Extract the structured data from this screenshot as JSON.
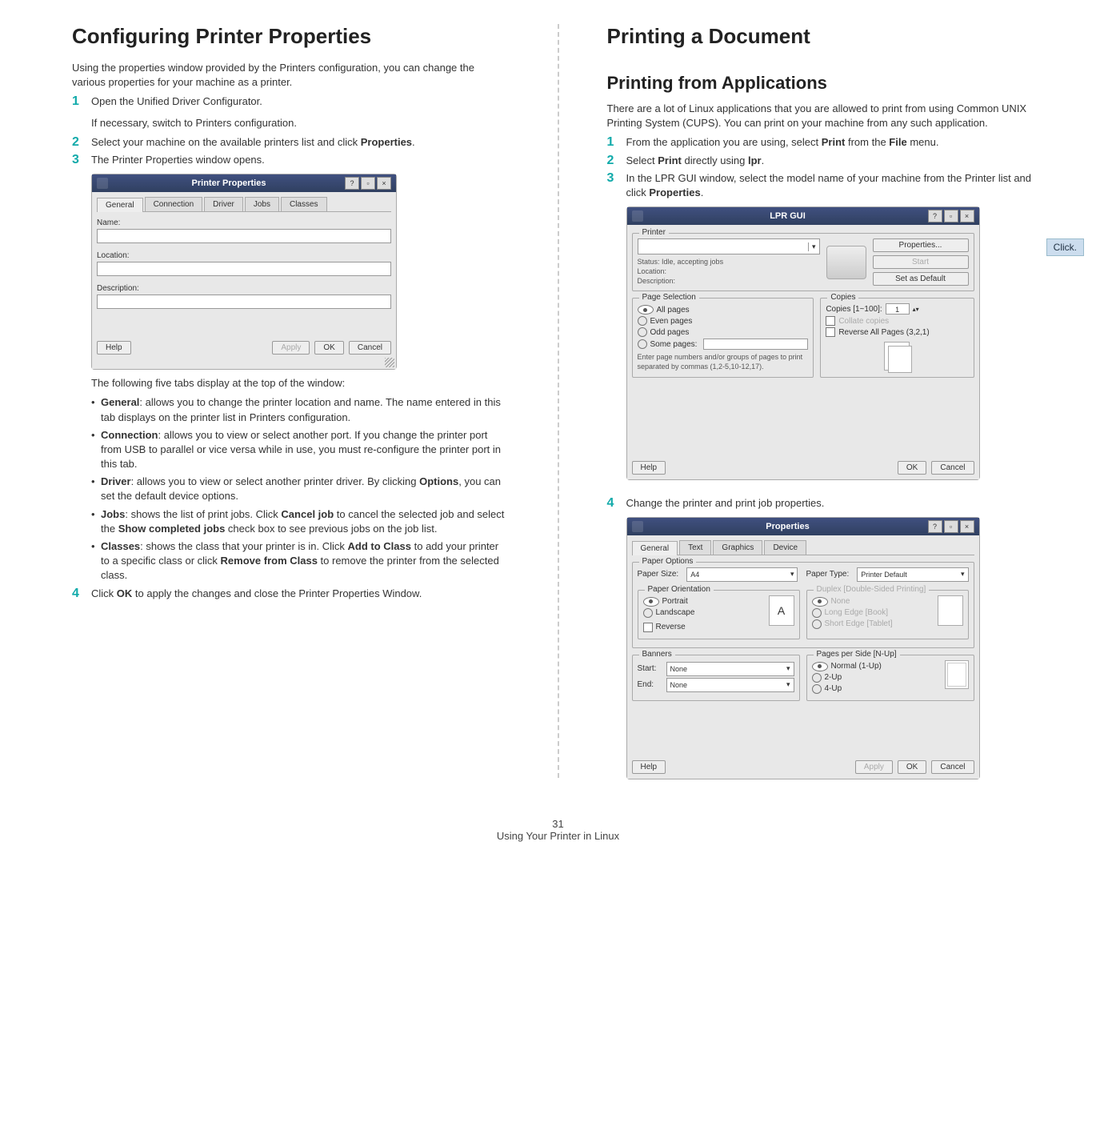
{
  "left": {
    "h1": "Configuring Printer Properties",
    "intro": "Using the properties window provided by the Printers configuration, you can change the various properties for your machine as a printer.",
    "step1": "Open the Unified Driver Configurator.",
    "step1b": "If necessary, switch to Printers configuration.",
    "step2_a": "Select your machine on the available printers list and click ",
    "step2_b": "Properties",
    "step2_c": ".",
    "step3": "The Printer Properties window opens.",
    "shot_pp": {
      "title": "Printer Properties",
      "tabs": [
        "General",
        "Connection",
        "Driver",
        "Jobs",
        "Classes"
      ],
      "f1": "Name:",
      "f2": "Location:",
      "f3": "Description:",
      "help": "Help",
      "apply": "Apply",
      "ok": "OK",
      "cancel": "Cancel"
    },
    "tabs_intro": "The following five tabs display at the top of the window:",
    "bul_general_t": "General",
    "bul_general": ": allows you to change the printer location and name. The name entered in this tab displays on the printer list in Printers configuration.",
    "bul_conn_t": "Connection",
    "bul_conn": ": allows you to view or select another port. If you change the printer port from USB to parallel or vice versa while in use, you must re-configure the printer port in this tab.",
    "bul_driver_t": "Driver",
    "bul_driver_a": ": allows you to view or select another printer driver. By clicking ",
    "bul_driver_b": "Options",
    "bul_driver_c": ", you can set the default device options.",
    "bul_jobs_t": "Jobs",
    "bul_jobs_a": ": shows the list of print jobs. Click ",
    "bul_jobs_b": "Cancel job",
    "bul_jobs_c": " to cancel the selected job and select the ",
    "bul_jobs_d": "Show completed jobs",
    "bul_jobs_e": " check box to see previous jobs on the job list.",
    "bul_classes_t": "Classes",
    "bul_classes_a": ": shows the class that your printer is in. Click ",
    "bul_classes_b": "Add to Class",
    "bul_classes_c": " to add your printer to a specific class or click ",
    "bul_classes_d": "Remove from Class",
    "bul_classes_e": " to remove the printer from the selected class.",
    "step4_a": "Click ",
    "step4_b": "OK",
    "step4_c": " to apply the changes and close the Printer Properties Window."
  },
  "right": {
    "h1": "Printing a Document",
    "h2": "Printing from Applications",
    "intro": "There are a lot of Linux applications that you are allowed to print from using Common UNIX Printing System (CUPS). You can print on your machine from any such application.",
    "s1_a": "From the application you are using, select ",
    "s1_b": "Print",
    "s1_c": " from the ",
    "s1_d": "File",
    "s1_e": " menu.",
    "s2_a": "Select ",
    "s2_b": "Print",
    "s2_c": " directly using ",
    "s2_d": "lpr",
    "s2_e": ".",
    "s3_a": "In the LPR GUI window, select the model name of your machine from the Printer list and click ",
    "s3_b": "Properties",
    "s3_c": ".",
    "callout": "Click.",
    "lpr": {
      "title": "LPR GUI",
      "printer": "Printer",
      "status": "Status: Idle, accepting jobs",
      "location": "Location:",
      "description": "Description:",
      "properties": "Properties...",
      "start": "Start",
      "setdefault": "Set as Default",
      "pagesel": "Page Selection",
      "allpages": "All pages",
      "even": "Even pages",
      "odd": "Odd pages",
      "some": "Some pages:",
      "hint": "Enter page numbers and/or groups of pages to print separated by commas (1,2-5,10-12,17).",
      "copies": "Copies",
      "copiesrange": "Copies [1~100]:",
      "copiesval": "1",
      "collate": "Collate copies",
      "reverse": "Reverse All Pages (3,2,1)",
      "help": "Help",
      "ok": "OK",
      "cancel": "Cancel"
    },
    "s4": "Change the printer and print job properties.",
    "prop": {
      "title": "Properties",
      "tabs": [
        "General",
        "Text",
        "Graphics",
        "Device"
      ],
      "paperopt": "Paper Options",
      "papersize": "Paper Size:",
      "a4": "A4",
      "papertype": "Paper Type:",
      "pdefault": "Printer Default",
      "orient": "Paper Orientation",
      "portrait": "Portrait",
      "landscape": "Landscape",
      "reverse": "Reverse",
      "duplex": "Duplex [Double-Sided Printing]",
      "none": "None",
      "longedge": "Long Edge [Book]",
      "shortedge": "Short Edge [Tablet]",
      "banners": "Banners",
      "start": "Start:",
      "end": "End:",
      "noneval": "None",
      "pps": "Pages per Side [N-Up]",
      "normal": "Normal (1-Up)",
      "two": "2-Up",
      "four": "4-Up",
      "help": "Help",
      "apply": "Apply",
      "ok": "OK",
      "cancel": "Cancel"
    }
  },
  "footer": {
    "page": "31",
    "section": "Using Your Printer in Linux"
  }
}
